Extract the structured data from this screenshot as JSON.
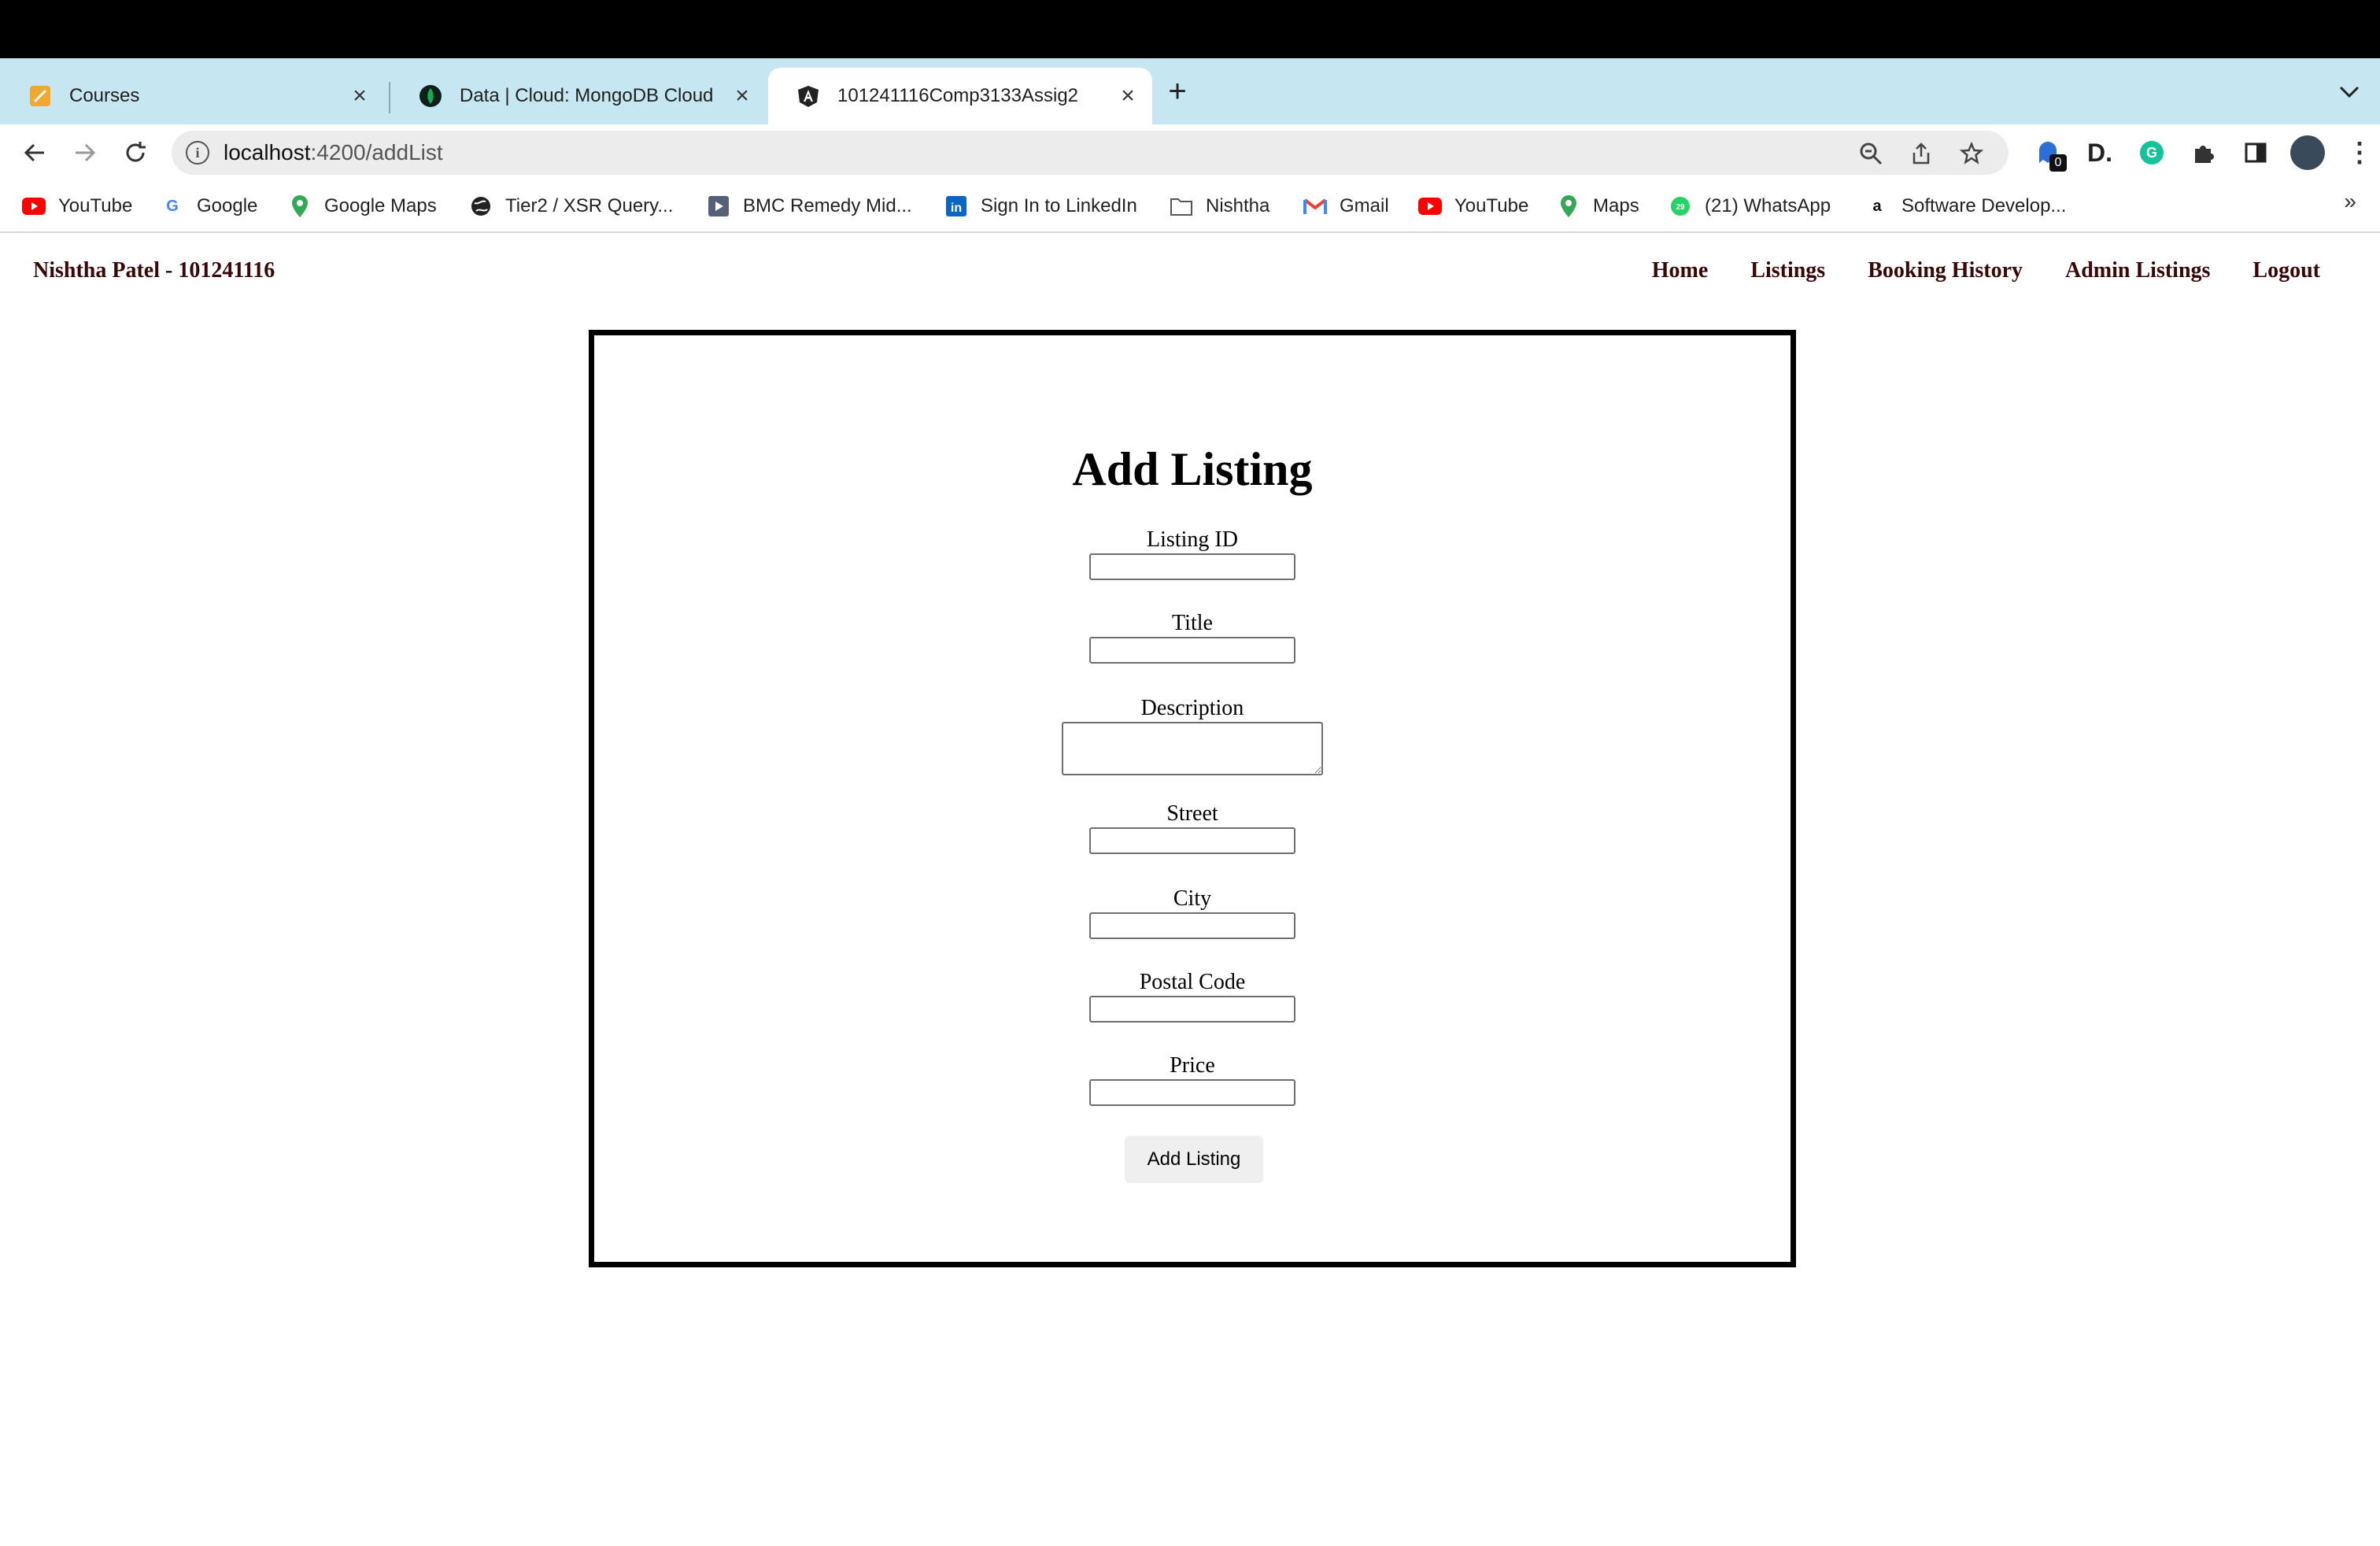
{
  "browser": {
    "tabs": [
      {
        "title": "Courses",
        "icon": "notes-icon"
      },
      {
        "title": "Data | Cloud: MongoDB Cloud",
        "icon": "mongodb-leaf-icon"
      },
      {
        "title": "101241116Comp3133Assig2",
        "icon": "angular-icon",
        "active": true
      }
    ],
    "address": {
      "host": "localhost",
      "path": ":4200/addList"
    },
    "bookmarks": [
      {
        "label": "YouTube",
        "icon": "youtube-icon"
      },
      {
        "label": "Google",
        "icon": "google-icon"
      },
      {
        "label": "Google Maps",
        "icon": "maps-pin-icon"
      },
      {
        "label": "Tier2 / XSR Query...",
        "icon": "globe-icon"
      },
      {
        "label": "BMC Remedy Mid...",
        "icon": "play-icon"
      },
      {
        "label": "Sign In to LinkedIn",
        "icon": "linkedin-icon"
      },
      {
        "label": "Nishtha",
        "icon": "folder-icon"
      },
      {
        "label": "Gmail",
        "icon": "gmail-icon"
      },
      {
        "label": "YouTube",
        "icon": "youtube-icon"
      },
      {
        "label": "Maps",
        "icon": "maps-pin-icon"
      },
      {
        "label": "(21) WhatsApp",
        "icon": "whatsapp-icon"
      },
      {
        "label": "Software Develop...",
        "icon": "amazon-icon"
      }
    ],
    "extension_badge": "0"
  },
  "app": {
    "brand": "Nishtha Patel - 101241116",
    "nav": [
      "Home",
      "Listings",
      "Booking History",
      "Admin Listings",
      "Logout"
    ]
  },
  "form": {
    "title": "Add Listing",
    "fields": [
      {
        "label": "Listing ID",
        "value": ""
      },
      {
        "label": "Title",
        "value": ""
      },
      {
        "label": "Description",
        "value": ""
      },
      {
        "label": "Street",
        "value": ""
      },
      {
        "label": "City",
        "value": ""
      },
      {
        "label": "Postal Code",
        "value": ""
      },
      {
        "label": "Price",
        "value": ""
      }
    ],
    "submit_label": "Add Listing"
  }
}
